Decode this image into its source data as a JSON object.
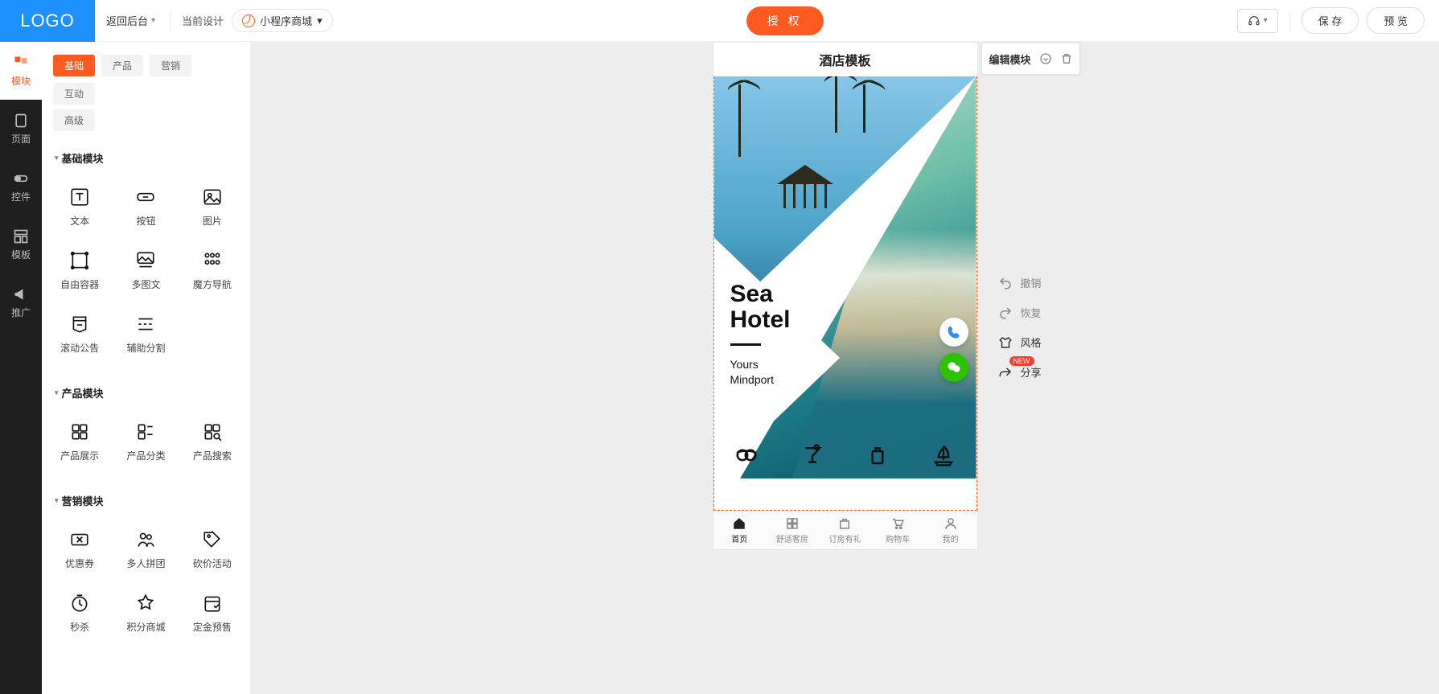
{
  "topbar": {
    "logo": "LOGO",
    "back": "返回后台",
    "current_design_label": "当前设计",
    "design_name": "小程序商城",
    "authorize": "授 权",
    "save": "保 存",
    "preview": "预 览"
  },
  "rail": [
    {
      "id": "modules",
      "label": "模块"
    },
    {
      "id": "pages",
      "label": "页面"
    },
    {
      "id": "controls",
      "label": "控件"
    },
    {
      "id": "templates",
      "label": "模板"
    },
    {
      "id": "promo",
      "label": "推广"
    }
  ],
  "panel_tabs": {
    "row1": [
      "基础",
      "产品",
      "营销",
      "互动"
    ],
    "row2": [
      "高级"
    ]
  },
  "sections": {
    "basic": {
      "title": "基础模块",
      "items": [
        "文本",
        "按钮",
        "图片",
        "自由容器",
        "多图文",
        "魔方导航",
        "滚动公告",
        "辅助分割"
      ]
    },
    "product": {
      "title": "产品模块",
      "items": [
        "产品展示",
        "产品分类",
        "产品搜索"
      ]
    },
    "marketing": {
      "title": "营销模块",
      "items": [
        "优惠券",
        "多人拼团",
        "砍价活动",
        "秒杀",
        "积分商城",
        "定金预售"
      ]
    }
  },
  "phone": {
    "page_title": "酒店模板",
    "toolbar": {
      "edit": "编辑模块"
    },
    "hero": {
      "title1": "Sea",
      "title2": "Hotel",
      "sub1": "Yours",
      "sub2": "Mindport"
    },
    "tabbar": [
      "首页",
      "舒适客房",
      "订房有礼",
      "购物车",
      "我的"
    ]
  },
  "canvas_tools": {
    "undo": "撤销",
    "redo": "恢复",
    "style": "风格",
    "share": "分享",
    "new_badge": "NEW"
  }
}
